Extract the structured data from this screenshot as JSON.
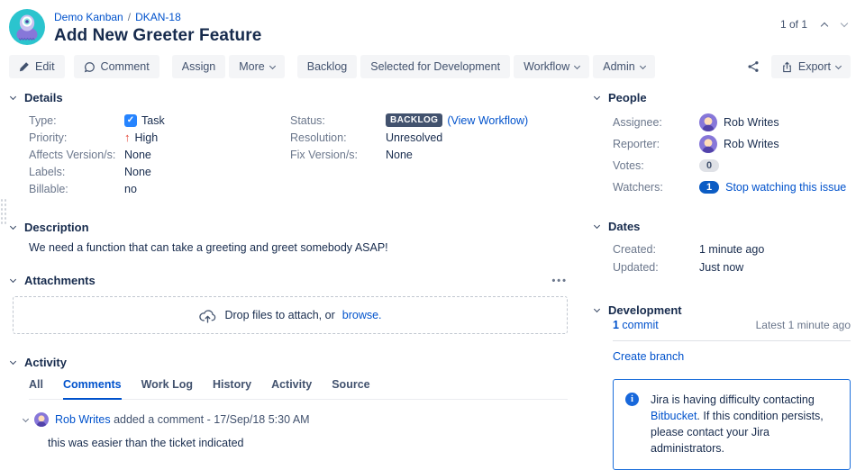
{
  "header": {
    "breadcrumb": {
      "project": "Demo Kanban",
      "separator": "/",
      "issue_key": "DKAN-18"
    },
    "title": "Add New Greeter Feature",
    "pager": {
      "count": "1 of 1"
    }
  },
  "toolbar": {
    "edit": "Edit",
    "comment": "Comment",
    "assign": "Assign",
    "more": "More",
    "backlog": "Backlog",
    "selected_for_development": "Selected for Development",
    "workflow": "Workflow",
    "admin": "Admin",
    "export": "Export"
  },
  "details": {
    "heading": "Details",
    "type_label": "Type:",
    "type_value": "Task",
    "type_icon_glyph": "✓",
    "priority_label": "Priority:",
    "priority_arrow": "↑",
    "priority_value": "High",
    "affects_label": "Affects Version/s:",
    "affects_value": "None",
    "labels_label": "Labels:",
    "labels_value": "None",
    "billable_label": "Billable:",
    "billable_value": "no",
    "status_label": "Status:",
    "status_badge": "BACKLOG",
    "status_link": "(View Workflow)",
    "resolution_label": "Resolution:",
    "resolution_value": "Unresolved",
    "fix_label": "Fix Version/s:",
    "fix_value": "None"
  },
  "description": {
    "heading": "Description",
    "text": "We need a function that can take a greeting and greet somebody ASAP!"
  },
  "attachments": {
    "heading": "Attachments",
    "menu": "•••",
    "drop_prefix": "Drop files to attach, or ",
    "drop_link": "browse."
  },
  "activity": {
    "heading": "Activity",
    "tabs": [
      "All",
      "Comments",
      "Work Log",
      "History",
      "Activity",
      "Source"
    ],
    "comment": {
      "author": "Rob Writes",
      "meta": " added a comment - 17/Sep/18 5:30 AM",
      "body": "this was easier than the ticket indicated"
    }
  },
  "people": {
    "heading": "People",
    "assignee_label": "Assignee:",
    "assignee": "Rob Writes",
    "reporter_label": "Reporter:",
    "reporter": "Rob Writes",
    "votes_label": "Votes:",
    "votes": "0",
    "watchers_label": "Watchers:",
    "watchers": "1",
    "watchers_link": "Stop watching this issue"
  },
  "dates": {
    "heading": "Dates",
    "created_label": "Created:",
    "created": "1 minute ago",
    "updated_label": "Updated:",
    "updated": "Just now"
  },
  "development": {
    "heading": "Development",
    "commit_count": "1",
    "commit_label": " commit",
    "latest": "Latest 1 minute ago",
    "create_branch": "Create branch"
  },
  "info_panel": {
    "icon_glyph": "i",
    "prefix": "Jira is having difficulty contacting ",
    "link": "Bitbucket",
    "suffix": ". If this condition persists, please contact your Jira administrators."
  },
  "colors": {
    "link_blue": "#0052CC",
    "text_dark": "#172B4D",
    "label_gray": "#6B778C",
    "badge_bg": "#42526E",
    "task_blue": "#2684FF",
    "priority_red": "#E5493A",
    "info_blue": "#1868DB",
    "button_bg": "#F4F5F7",
    "avatar_purple": "#8777D9",
    "project_teal": "#2BC4CE"
  }
}
